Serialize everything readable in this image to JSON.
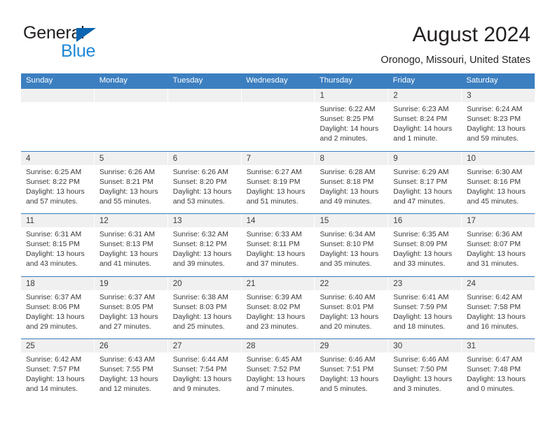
{
  "brand": {
    "name_part1": "General",
    "name_part2": "Blue",
    "logo_triangle_icon": "triangle-icon",
    "color_dark": "#231f20",
    "color_blue": "#1e87d6"
  },
  "header": {
    "title": "August 2024",
    "subtitle": "Oronogo, Missouri, United States"
  },
  "theme": {
    "header_blue": "#3c7fc0",
    "daynum_band": "#f0f0f0",
    "text": "#3a3a3a"
  },
  "weekdays": [
    "Sunday",
    "Monday",
    "Tuesday",
    "Wednesday",
    "Thursday",
    "Friday",
    "Saturday"
  ],
  "weeks": [
    [
      {
        "day": "",
        "sunrise": "",
        "sunset": "",
        "daylight1": "",
        "daylight2": ""
      },
      {
        "day": "",
        "sunrise": "",
        "sunset": "",
        "daylight1": "",
        "daylight2": ""
      },
      {
        "day": "",
        "sunrise": "",
        "sunset": "",
        "daylight1": "",
        "daylight2": ""
      },
      {
        "day": "",
        "sunrise": "",
        "sunset": "",
        "daylight1": "",
        "daylight2": ""
      },
      {
        "day": "1",
        "sunrise": "Sunrise: 6:22 AM",
        "sunset": "Sunset: 8:25 PM",
        "daylight1": "Daylight: 14 hours",
        "daylight2": "and 2 minutes."
      },
      {
        "day": "2",
        "sunrise": "Sunrise: 6:23 AM",
        "sunset": "Sunset: 8:24 PM",
        "daylight1": "Daylight: 14 hours",
        "daylight2": "and 1 minute."
      },
      {
        "day": "3",
        "sunrise": "Sunrise: 6:24 AM",
        "sunset": "Sunset: 8:23 PM",
        "daylight1": "Daylight: 13 hours",
        "daylight2": "and 59 minutes."
      }
    ],
    [
      {
        "day": "4",
        "sunrise": "Sunrise: 6:25 AM",
        "sunset": "Sunset: 8:22 PM",
        "daylight1": "Daylight: 13 hours",
        "daylight2": "and 57 minutes."
      },
      {
        "day": "5",
        "sunrise": "Sunrise: 6:26 AM",
        "sunset": "Sunset: 8:21 PM",
        "daylight1": "Daylight: 13 hours",
        "daylight2": "and 55 minutes."
      },
      {
        "day": "6",
        "sunrise": "Sunrise: 6:26 AM",
        "sunset": "Sunset: 8:20 PM",
        "daylight1": "Daylight: 13 hours",
        "daylight2": "and 53 minutes."
      },
      {
        "day": "7",
        "sunrise": "Sunrise: 6:27 AM",
        "sunset": "Sunset: 8:19 PM",
        "daylight1": "Daylight: 13 hours",
        "daylight2": "and 51 minutes."
      },
      {
        "day": "8",
        "sunrise": "Sunrise: 6:28 AM",
        "sunset": "Sunset: 8:18 PM",
        "daylight1": "Daylight: 13 hours",
        "daylight2": "and 49 minutes."
      },
      {
        "day": "9",
        "sunrise": "Sunrise: 6:29 AM",
        "sunset": "Sunset: 8:17 PM",
        "daylight1": "Daylight: 13 hours",
        "daylight2": "and 47 minutes."
      },
      {
        "day": "10",
        "sunrise": "Sunrise: 6:30 AM",
        "sunset": "Sunset: 8:16 PM",
        "daylight1": "Daylight: 13 hours",
        "daylight2": "and 45 minutes."
      }
    ],
    [
      {
        "day": "11",
        "sunrise": "Sunrise: 6:31 AM",
        "sunset": "Sunset: 8:15 PM",
        "daylight1": "Daylight: 13 hours",
        "daylight2": "and 43 minutes."
      },
      {
        "day": "12",
        "sunrise": "Sunrise: 6:31 AM",
        "sunset": "Sunset: 8:13 PM",
        "daylight1": "Daylight: 13 hours",
        "daylight2": "and 41 minutes."
      },
      {
        "day": "13",
        "sunrise": "Sunrise: 6:32 AM",
        "sunset": "Sunset: 8:12 PM",
        "daylight1": "Daylight: 13 hours",
        "daylight2": "and 39 minutes."
      },
      {
        "day": "14",
        "sunrise": "Sunrise: 6:33 AM",
        "sunset": "Sunset: 8:11 PM",
        "daylight1": "Daylight: 13 hours",
        "daylight2": "and 37 minutes."
      },
      {
        "day": "15",
        "sunrise": "Sunrise: 6:34 AM",
        "sunset": "Sunset: 8:10 PM",
        "daylight1": "Daylight: 13 hours",
        "daylight2": "and 35 minutes."
      },
      {
        "day": "16",
        "sunrise": "Sunrise: 6:35 AM",
        "sunset": "Sunset: 8:09 PM",
        "daylight1": "Daylight: 13 hours",
        "daylight2": "and 33 minutes."
      },
      {
        "day": "17",
        "sunrise": "Sunrise: 6:36 AM",
        "sunset": "Sunset: 8:07 PM",
        "daylight1": "Daylight: 13 hours",
        "daylight2": "and 31 minutes."
      }
    ],
    [
      {
        "day": "18",
        "sunrise": "Sunrise: 6:37 AM",
        "sunset": "Sunset: 8:06 PM",
        "daylight1": "Daylight: 13 hours",
        "daylight2": "and 29 minutes."
      },
      {
        "day": "19",
        "sunrise": "Sunrise: 6:37 AM",
        "sunset": "Sunset: 8:05 PM",
        "daylight1": "Daylight: 13 hours",
        "daylight2": "and 27 minutes."
      },
      {
        "day": "20",
        "sunrise": "Sunrise: 6:38 AM",
        "sunset": "Sunset: 8:03 PM",
        "daylight1": "Daylight: 13 hours",
        "daylight2": "and 25 minutes."
      },
      {
        "day": "21",
        "sunrise": "Sunrise: 6:39 AM",
        "sunset": "Sunset: 8:02 PM",
        "daylight1": "Daylight: 13 hours",
        "daylight2": "and 23 minutes."
      },
      {
        "day": "22",
        "sunrise": "Sunrise: 6:40 AM",
        "sunset": "Sunset: 8:01 PM",
        "daylight1": "Daylight: 13 hours",
        "daylight2": "and 20 minutes."
      },
      {
        "day": "23",
        "sunrise": "Sunrise: 6:41 AM",
        "sunset": "Sunset: 7:59 PM",
        "daylight1": "Daylight: 13 hours",
        "daylight2": "and 18 minutes."
      },
      {
        "day": "24",
        "sunrise": "Sunrise: 6:42 AM",
        "sunset": "Sunset: 7:58 PM",
        "daylight1": "Daylight: 13 hours",
        "daylight2": "and 16 minutes."
      }
    ],
    [
      {
        "day": "25",
        "sunrise": "Sunrise: 6:42 AM",
        "sunset": "Sunset: 7:57 PM",
        "daylight1": "Daylight: 13 hours",
        "daylight2": "and 14 minutes."
      },
      {
        "day": "26",
        "sunrise": "Sunrise: 6:43 AM",
        "sunset": "Sunset: 7:55 PM",
        "daylight1": "Daylight: 13 hours",
        "daylight2": "and 12 minutes."
      },
      {
        "day": "27",
        "sunrise": "Sunrise: 6:44 AM",
        "sunset": "Sunset: 7:54 PM",
        "daylight1": "Daylight: 13 hours",
        "daylight2": "and 9 minutes."
      },
      {
        "day": "28",
        "sunrise": "Sunrise: 6:45 AM",
        "sunset": "Sunset: 7:52 PM",
        "daylight1": "Daylight: 13 hours",
        "daylight2": "and 7 minutes."
      },
      {
        "day": "29",
        "sunrise": "Sunrise: 6:46 AM",
        "sunset": "Sunset: 7:51 PM",
        "daylight1": "Daylight: 13 hours",
        "daylight2": "and 5 minutes."
      },
      {
        "day": "30",
        "sunrise": "Sunrise: 6:46 AM",
        "sunset": "Sunset: 7:50 PM",
        "daylight1": "Daylight: 13 hours",
        "daylight2": "and 3 minutes."
      },
      {
        "day": "31",
        "sunrise": "Sunrise: 6:47 AM",
        "sunset": "Sunset: 7:48 PM",
        "daylight1": "Daylight: 13 hours",
        "daylight2": "and 0 minutes."
      }
    ]
  ]
}
